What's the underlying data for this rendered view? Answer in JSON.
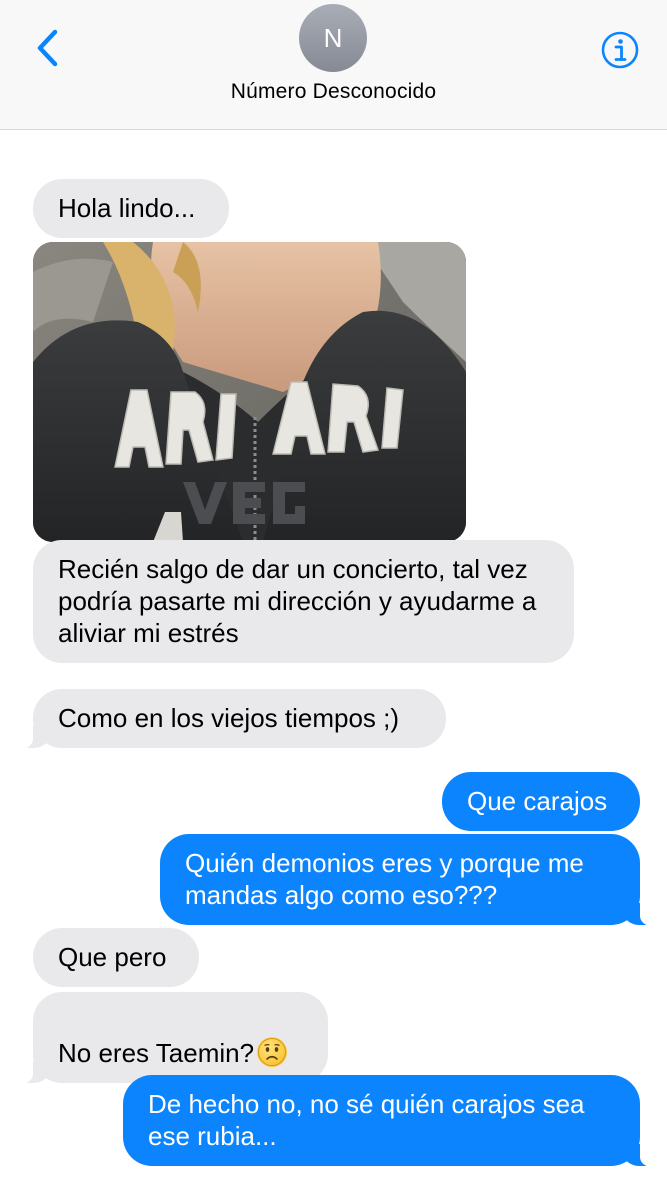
{
  "header": {
    "contact_initial": "N",
    "contact_name": "Número Desconocido",
    "back_icon": "chevron-left-icon",
    "info_icon": "info-circle-icon"
  },
  "colors": {
    "accent": "#0b84fe",
    "incoming_bubble": "#e9e9eb",
    "header_bg": "#f8f8f9"
  },
  "messages": [
    {
      "from": "them",
      "text": "Hola lindo..."
    },
    {
      "from": "them",
      "type": "image",
      "image_text": "ARI ARI VEGAS"
    },
    {
      "from": "them",
      "text": "Recién salgo de dar un concierto, tal vez podría pasarte mi dirección y ayudarme a aliviar mi estrés"
    },
    {
      "from": "them",
      "text": "Como en los viejos tiempos ;)"
    },
    {
      "from": "me",
      "text": "Que carajos"
    },
    {
      "from": "me",
      "text": "Quién demonios eres y porque me mandas algo como eso???"
    },
    {
      "from": "them",
      "text": "Que pero"
    },
    {
      "from": "them",
      "text": "No eres Taemin?",
      "emoji": "worried-face-emoji"
    },
    {
      "from": "me",
      "text": "De hecho no, no sé quién carajos sea ese rubia..."
    }
  ]
}
